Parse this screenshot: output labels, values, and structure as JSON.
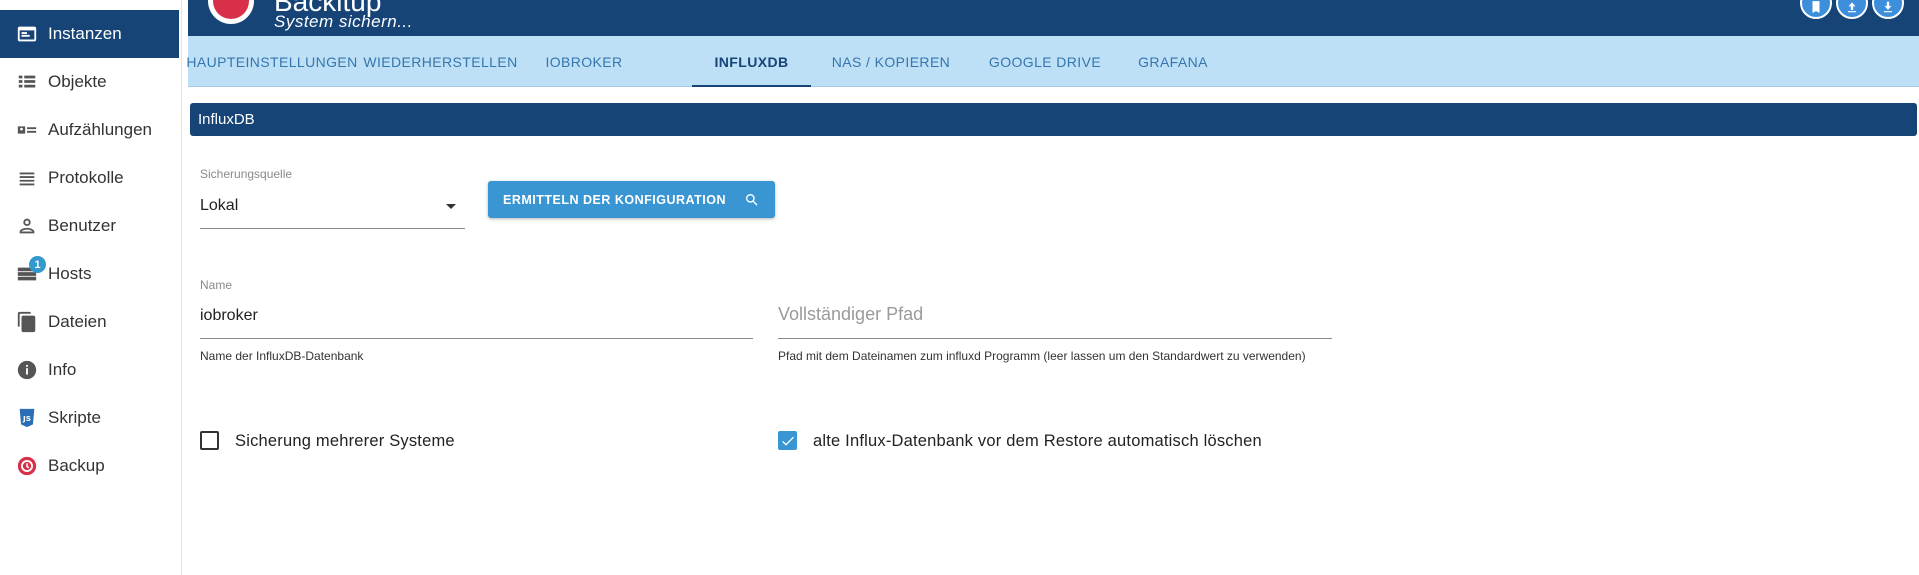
{
  "sidebar": {
    "items": [
      {
        "label": "Instanzen",
        "icon": "instances-icon",
        "active": true
      },
      {
        "label": "Objekte",
        "icon": "objects-icon"
      },
      {
        "label": "Aufzählungen",
        "icon": "enums-icon"
      },
      {
        "label": "Protokolle",
        "icon": "logs-icon"
      },
      {
        "label": "Benutzer",
        "icon": "user-icon"
      },
      {
        "label": "Hosts",
        "icon": "hosts-icon",
        "badge": "1"
      },
      {
        "label": "Dateien",
        "icon": "files-icon"
      },
      {
        "label": "Info",
        "icon": "info-icon"
      },
      {
        "label": "Skripte",
        "icon": "js-icon"
      },
      {
        "label": "Backup",
        "icon": "backup-icon"
      }
    ]
  },
  "header": {
    "title": "Backitup",
    "subtitle": "System sichern..."
  },
  "tabs": [
    {
      "label": "HAUPTEINSTELLUNGEN"
    },
    {
      "label": "WIEDERHERSTELLEN"
    },
    {
      "label": "IOBROKER"
    },
    {
      "label": "INFLUXDB",
      "active": true
    },
    {
      "label": "NAS / KOPIEREN"
    },
    {
      "label": "GOOGLE DRIVE"
    },
    {
      "label": "GRAFANA"
    }
  ],
  "section": {
    "title": "InfluxDB"
  },
  "form": {
    "source": {
      "label": "Sicherungsquelle",
      "value": "Lokal"
    },
    "detect_button": "ERMITTELN DER KONFIGURATION",
    "name": {
      "label": "Name",
      "value": "iobroker",
      "helper": "Name der InfluxDB-Datenbank"
    },
    "path": {
      "placeholder": "Vollständiger Pfad",
      "helper": "Pfad mit dem Dateinamen zum influxd Programm (leer lassen um den Standardwert zu verwenden)"
    },
    "multi_system": {
      "label": "Sicherung mehrerer Systeme",
      "checked": false
    },
    "delete_old": {
      "label": "alte Influx-Datenbank vor dem Restore automatisch löschen",
      "checked": true
    }
  },
  "colors": {
    "primary": "#164477",
    "tab_bar": "#bde0f7",
    "accent": "#3a96d3",
    "logo_red": "#d9304a"
  }
}
